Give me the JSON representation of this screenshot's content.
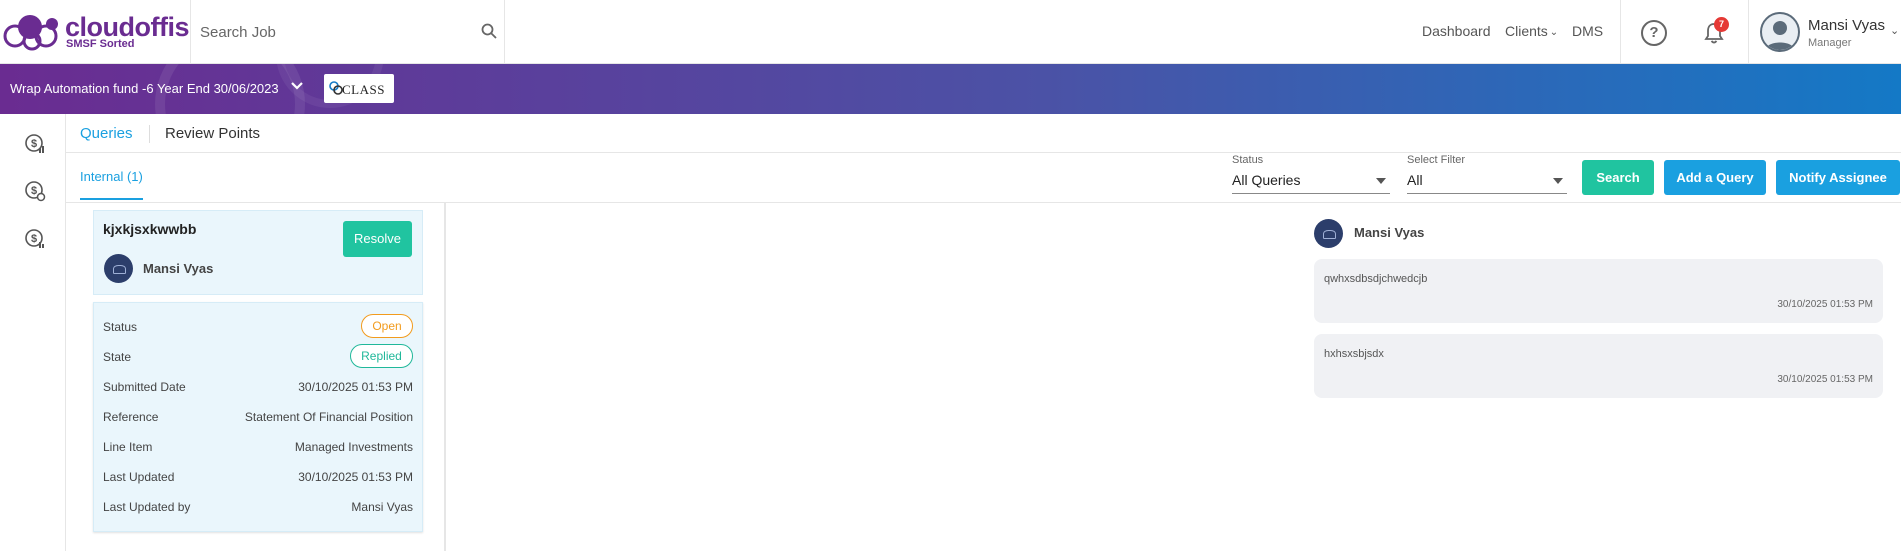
{
  "header": {
    "brand_name": "cloudoffis",
    "brand_tagline": "SMSF Sorted",
    "search_placeholder": "Search Job",
    "nav": {
      "dashboard": "Dashboard",
      "clients": "Clients",
      "dms": "DMS"
    },
    "help_symbol": "?",
    "notification_count": "7",
    "user_name": "Mansi Vyas",
    "user_role": "Manager"
  },
  "banner": {
    "fund_title": "Wrap Automation fund -6 Year End 30/06/2023",
    "class_logo_text": "CLASS"
  },
  "sidebar": {
    "icons": [
      "dollar-chart-icon",
      "dollar-settings-icon",
      "dollar-report-icon"
    ]
  },
  "tabs": {
    "queries": "Queries",
    "review_points": "Review Points"
  },
  "subtab": "Internal (1)",
  "filters": {
    "status_label": "Status",
    "status_value": "All Queries",
    "select_filter_label": "Select Filter",
    "select_filter_value": "All"
  },
  "buttons": {
    "search": "Search",
    "add_query": "Add a Query",
    "notify_assignee": "Notify Assignee",
    "resolve": "Resolve"
  },
  "query": {
    "title": "kjxkjsxkwwbb",
    "user": "Mansi Vyas",
    "details": [
      {
        "label": "Status",
        "value": "Open"
      },
      {
        "label": "State",
        "value": "Replied"
      },
      {
        "label": "Submitted Date",
        "value": "30/10/2025 01:53 PM"
      },
      {
        "label": "Reference",
        "value": "Statement Of Financial Position"
      },
      {
        "label": "Line Item",
        "value": "Managed Investments"
      },
      {
        "label": "Last Updated",
        "value": "30/10/2025 01:53 PM"
      },
      {
        "label": "Last Updated by",
        "value": "Mansi Vyas"
      }
    ]
  },
  "conversation": {
    "user": "Mansi Vyas",
    "messages": [
      {
        "text": "qwhxsdbsdjchwedcjb",
        "time": "30/10/2025 01:53 PM"
      },
      {
        "text": "hxhsxsbjsdx",
        "time": "30/10/2025 01:53 PM"
      }
    ]
  },
  "colors": {
    "brand_purple": "#6a2c91",
    "accent_blue": "#1aa0e0",
    "search_green": "#20c4a0",
    "open_orange": "#f29b1d",
    "replied_teal": "#20b89a"
  }
}
